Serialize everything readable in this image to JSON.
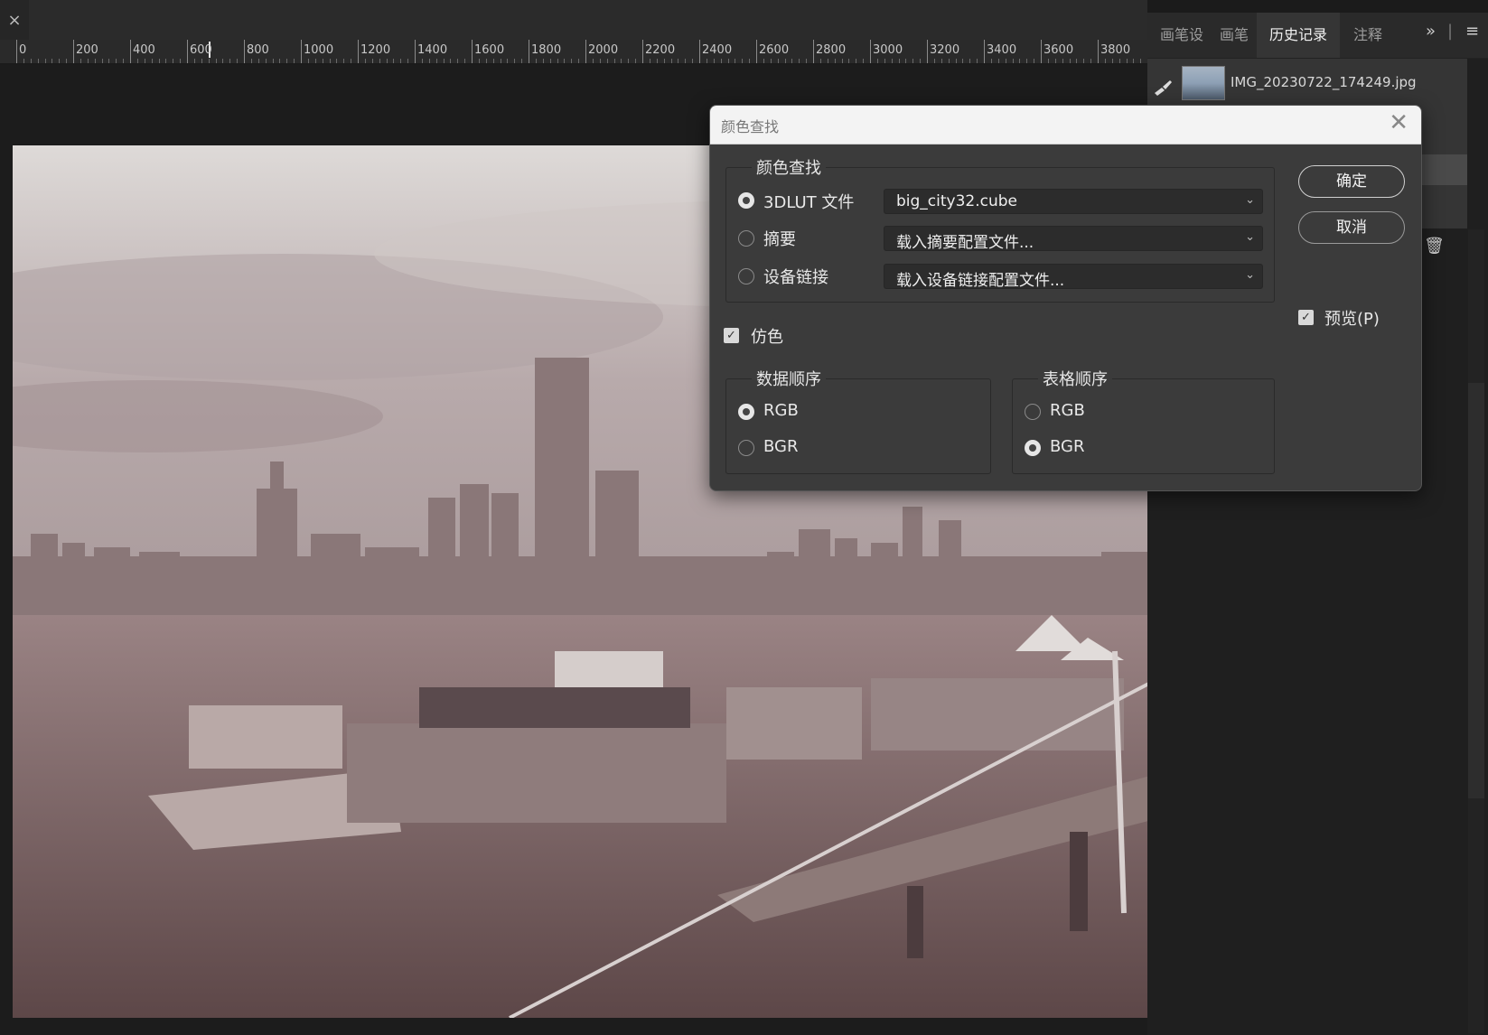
{
  "window": {
    "close_label": "×"
  },
  "ruler": {
    "labels": [
      "0",
      "200",
      "400",
      "600",
      "800",
      "1000",
      "1200",
      "1400",
      "1600",
      "1800",
      "2000",
      "2200",
      "2400",
      "2600",
      "2800",
      "3000",
      "3200",
      "3400",
      "3600",
      "3800"
    ]
  },
  "panel": {
    "tabs": [
      "画笔设",
      "画笔",
      "历史记录",
      "注释"
    ],
    "active_tab": "历史记录",
    "more_label": "»",
    "menu_label": "≡",
    "history": {
      "item_name": "IMG_20230722_174249.jpg"
    },
    "trash_label": "🗑"
  },
  "dialog": {
    "title": "颜色查找",
    "close_label": "✕",
    "color_lookup_group": {
      "legend": "颜色查找",
      "options": [
        {
          "label": "3DLUT 文件",
          "selected": true,
          "value": "big_city32.cube"
        },
        {
          "label": "摘要",
          "selected": false,
          "value": "载入摘要配置文件..."
        },
        {
          "label": "设备链接",
          "selected": false,
          "value": "载入设备链接配置文件..."
        }
      ]
    },
    "dither": {
      "label": "仿色",
      "checked": true
    },
    "data_order": {
      "legend": "数据顺序",
      "options": [
        "RGB",
        "BGR"
      ],
      "selected": "RGB"
    },
    "table_order": {
      "legend": "表格顺序",
      "options": [
        "RGB",
        "BGR"
      ],
      "selected": "BGR"
    },
    "ok_label": "确定",
    "cancel_label": "取消",
    "preview": {
      "label": "预览(P)",
      "checked": true
    },
    "check_glyph": "✓",
    "chevron": "⌄"
  }
}
